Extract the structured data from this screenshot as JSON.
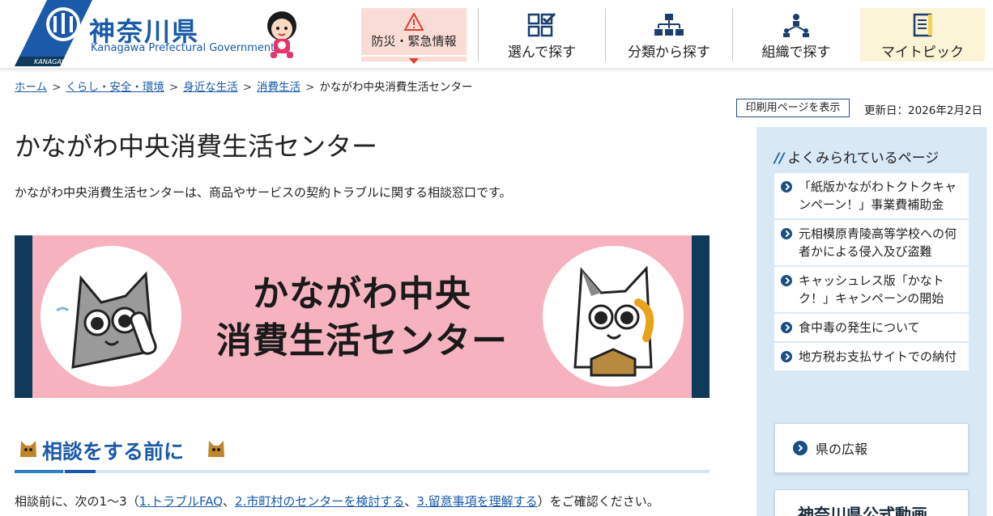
{
  "header": {
    "logo": {
      "mark_text": "KANAGAWA",
      "name_ja": "神奈川県",
      "name_en": "Kanagawa Prefectural Government"
    },
    "nav": [
      {
        "label": "防災・緊急情報",
        "icon": "warning-icon"
      },
      {
        "label": "選んで探す",
        "icon": "select-grid-icon"
      },
      {
        "label": "分類から探す",
        "icon": "category-tree-icon"
      },
      {
        "label": "組織で探す",
        "icon": "organization-icon"
      },
      {
        "label": "マイトピック",
        "icon": "notebook-icon"
      }
    ]
  },
  "breadcrumb": {
    "items": [
      "ホーム",
      "くらし・安全・環境",
      "身近な生活",
      "消費生活"
    ],
    "current": "かながわ中央消費生活センター",
    "separator": ">"
  },
  "tools": {
    "print_label": "印刷用ページを表示",
    "updated": "更新日：2026年2月2日"
  },
  "main": {
    "title": "かながわ中央消費生活センター",
    "lead": "かながわ中央消費生活センターは、商品やサービスの契約トラブルに関する相談窓口です。",
    "banner": {
      "line1": "かながわ中央",
      "line2": "消費生活センター"
    },
    "section_heading": "相談をする前に",
    "para": {
      "prefix": "相談前に、次の1〜3（",
      "link1": "1.トラブルFAQ",
      "sep1": "、",
      "link2": "2.市町村のセンターを検討する",
      "sep2": "、",
      "link3": "3.留意事項を理解する",
      "suffix": "）をご確認ください。"
    }
  },
  "sidebar": {
    "popular_heading": "よくみられているページ",
    "popular_items": [
      "「紙版かながわトクトクキャンペーン！」事業費補助金",
      "元相模原青陵高等学校への何者かによる侵入及び盗難",
      "キャッシュレス版「かなトク！」キャンペーンの開始",
      "食中毒の発生について",
      "地方税お支払サイトでの納付"
    ],
    "pr_label": "県の広報",
    "video_label": "神奈川県公式動画"
  },
  "colors": {
    "brand_blue": "#1a5aa8",
    "emergency_bg": "#fadcd6",
    "mytopic_bg": "#fbf4d6",
    "banner_pink": "#f6b3bf",
    "banner_navy": "#103a5c",
    "sidebar_bg": "#d8e8f5"
  }
}
